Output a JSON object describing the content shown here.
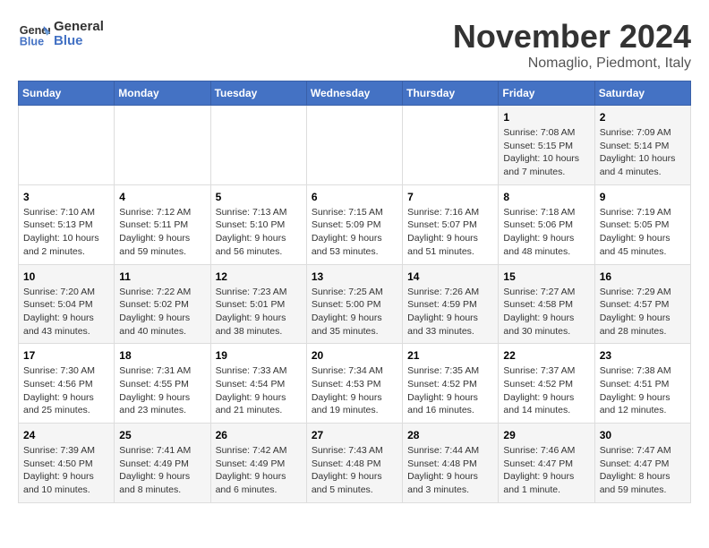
{
  "header": {
    "logo_line1": "General",
    "logo_line2": "Blue",
    "month_title": "November 2024",
    "location": "Nomaglio, Piedmont, Italy"
  },
  "weekdays": [
    "Sunday",
    "Monday",
    "Tuesday",
    "Wednesday",
    "Thursday",
    "Friday",
    "Saturday"
  ],
  "weeks": [
    [
      {
        "day": "",
        "info": ""
      },
      {
        "day": "",
        "info": ""
      },
      {
        "day": "",
        "info": ""
      },
      {
        "day": "",
        "info": ""
      },
      {
        "day": "",
        "info": ""
      },
      {
        "day": "1",
        "info": "Sunrise: 7:08 AM\nSunset: 5:15 PM\nDaylight: 10 hours and 7 minutes."
      },
      {
        "day": "2",
        "info": "Sunrise: 7:09 AM\nSunset: 5:14 PM\nDaylight: 10 hours and 4 minutes."
      }
    ],
    [
      {
        "day": "3",
        "info": "Sunrise: 7:10 AM\nSunset: 5:13 PM\nDaylight: 10 hours and 2 minutes."
      },
      {
        "day": "4",
        "info": "Sunrise: 7:12 AM\nSunset: 5:11 PM\nDaylight: 9 hours and 59 minutes."
      },
      {
        "day": "5",
        "info": "Sunrise: 7:13 AM\nSunset: 5:10 PM\nDaylight: 9 hours and 56 minutes."
      },
      {
        "day": "6",
        "info": "Sunrise: 7:15 AM\nSunset: 5:09 PM\nDaylight: 9 hours and 53 minutes."
      },
      {
        "day": "7",
        "info": "Sunrise: 7:16 AM\nSunset: 5:07 PM\nDaylight: 9 hours and 51 minutes."
      },
      {
        "day": "8",
        "info": "Sunrise: 7:18 AM\nSunset: 5:06 PM\nDaylight: 9 hours and 48 minutes."
      },
      {
        "day": "9",
        "info": "Sunrise: 7:19 AM\nSunset: 5:05 PM\nDaylight: 9 hours and 45 minutes."
      }
    ],
    [
      {
        "day": "10",
        "info": "Sunrise: 7:20 AM\nSunset: 5:04 PM\nDaylight: 9 hours and 43 minutes."
      },
      {
        "day": "11",
        "info": "Sunrise: 7:22 AM\nSunset: 5:02 PM\nDaylight: 9 hours and 40 minutes."
      },
      {
        "day": "12",
        "info": "Sunrise: 7:23 AM\nSunset: 5:01 PM\nDaylight: 9 hours and 38 minutes."
      },
      {
        "day": "13",
        "info": "Sunrise: 7:25 AM\nSunset: 5:00 PM\nDaylight: 9 hours and 35 minutes."
      },
      {
        "day": "14",
        "info": "Sunrise: 7:26 AM\nSunset: 4:59 PM\nDaylight: 9 hours and 33 minutes."
      },
      {
        "day": "15",
        "info": "Sunrise: 7:27 AM\nSunset: 4:58 PM\nDaylight: 9 hours and 30 minutes."
      },
      {
        "day": "16",
        "info": "Sunrise: 7:29 AM\nSunset: 4:57 PM\nDaylight: 9 hours and 28 minutes."
      }
    ],
    [
      {
        "day": "17",
        "info": "Sunrise: 7:30 AM\nSunset: 4:56 PM\nDaylight: 9 hours and 25 minutes."
      },
      {
        "day": "18",
        "info": "Sunrise: 7:31 AM\nSunset: 4:55 PM\nDaylight: 9 hours and 23 minutes."
      },
      {
        "day": "19",
        "info": "Sunrise: 7:33 AM\nSunset: 4:54 PM\nDaylight: 9 hours and 21 minutes."
      },
      {
        "day": "20",
        "info": "Sunrise: 7:34 AM\nSunset: 4:53 PM\nDaylight: 9 hours and 19 minutes."
      },
      {
        "day": "21",
        "info": "Sunrise: 7:35 AM\nSunset: 4:52 PM\nDaylight: 9 hours and 16 minutes."
      },
      {
        "day": "22",
        "info": "Sunrise: 7:37 AM\nSunset: 4:52 PM\nDaylight: 9 hours and 14 minutes."
      },
      {
        "day": "23",
        "info": "Sunrise: 7:38 AM\nSunset: 4:51 PM\nDaylight: 9 hours and 12 minutes."
      }
    ],
    [
      {
        "day": "24",
        "info": "Sunrise: 7:39 AM\nSunset: 4:50 PM\nDaylight: 9 hours and 10 minutes."
      },
      {
        "day": "25",
        "info": "Sunrise: 7:41 AM\nSunset: 4:49 PM\nDaylight: 9 hours and 8 minutes."
      },
      {
        "day": "26",
        "info": "Sunrise: 7:42 AM\nSunset: 4:49 PM\nDaylight: 9 hours and 6 minutes."
      },
      {
        "day": "27",
        "info": "Sunrise: 7:43 AM\nSunset: 4:48 PM\nDaylight: 9 hours and 5 minutes."
      },
      {
        "day": "28",
        "info": "Sunrise: 7:44 AM\nSunset: 4:48 PM\nDaylight: 9 hours and 3 minutes."
      },
      {
        "day": "29",
        "info": "Sunrise: 7:46 AM\nSunset: 4:47 PM\nDaylight: 9 hours and 1 minute."
      },
      {
        "day": "30",
        "info": "Sunrise: 7:47 AM\nSunset: 4:47 PM\nDaylight: 8 hours and 59 minutes."
      }
    ]
  ]
}
